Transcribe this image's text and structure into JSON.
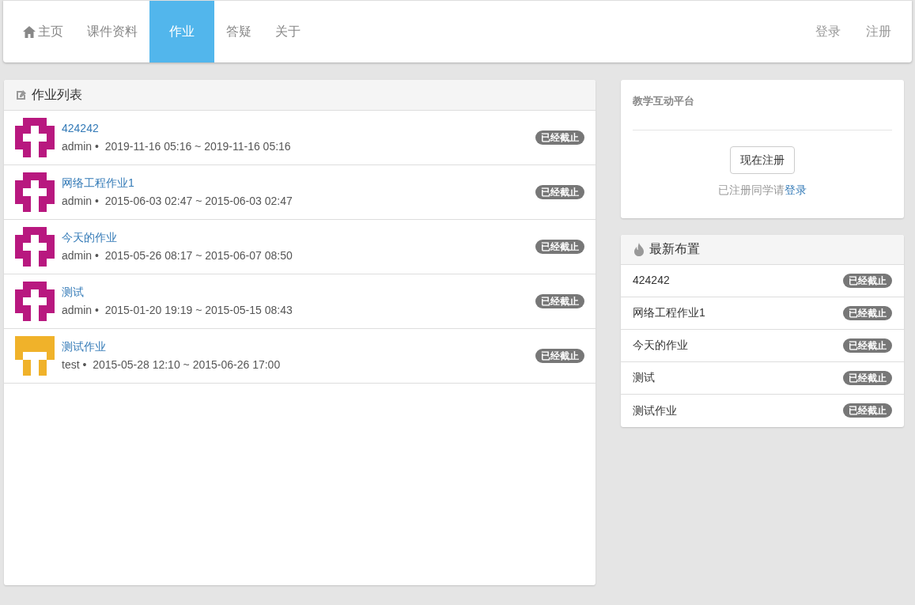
{
  "nav": {
    "items": [
      {
        "label": "主页",
        "kind": "home",
        "selected": false
      },
      {
        "label": "课件资料",
        "kind": "text",
        "selected": false
      },
      {
        "label": "作业",
        "kind": "text",
        "selected": true
      },
      {
        "label": "答疑",
        "kind": "text",
        "selected": false
      },
      {
        "label": "关于",
        "kind": "text",
        "selected": false
      }
    ],
    "right": [
      "登录",
      "注册"
    ]
  },
  "homework_list": {
    "title": "作业列表",
    "items": [
      {
        "title": "424242",
        "author": "admin",
        "separator": "•",
        "period": "2019-11-16 05:16 ~ 2019-11-16 05:16",
        "status": "已经截止",
        "avatar": {
          "kind": "cross",
          "color": "#b8187f"
        }
      },
      {
        "title": "网络工程作业1",
        "author": "admin",
        "separator": "•",
        "period": "2015-06-03 02:47 ~ 2015-06-03 02:47",
        "status": "已经截止",
        "avatar": {
          "kind": "cross",
          "color": "#b8187f"
        }
      },
      {
        "title": "今天的作业",
        "author": "admin",
        "separator": "•",
        "period": "2015-05-26 08:17 ~ 2015-06-07 08:50",
        "status": "已经截止",
        "avatar": {
          "kind": "cross",
          "color": "#b8187f"
        }
      },
      {
        "title": "测试",
        "author": "admin",
        "separator": "•",
        "period": "2015-01-20 19:19 ~ 2015-05-15 08:43",
        "status": "已经截止",
        "avatar": {
          "kind": "cross",
          "color": "#b8187f"
        }
      },
      {
        "title": "测试作业",
        "author": "test",
        "separator": "•",
        "period": "2015-05-28 12:10 ~ 2015-06-26 17:00",
        "status": "已经截止",
        "avatar": {
          "kind": "gate",
          "color": "#f0b22a"
        }
      }
    ]
  },
  "platform": {
    "title": "教学互动平台",
    "register_button": "现在注册",
    "login_prompt": "已注册同学请",
    "login_link": "登录"
  },
  "latest": {
    "title": "最新布置",
    "items": [
      {
        "title": "424242",
        "status": "已经截止"
      },
      {
        "title": "网络工程作业1",
        "status": "已经截止"
      },
      {
        "title": "今天的作业",
        "status": "已经截止"
      },
      {
        "title": "测试",
        "status": "已经截止"
      },
      {
        "title": "测试作业",
        "status": "已经截止"
      }
    ]
  }
}
